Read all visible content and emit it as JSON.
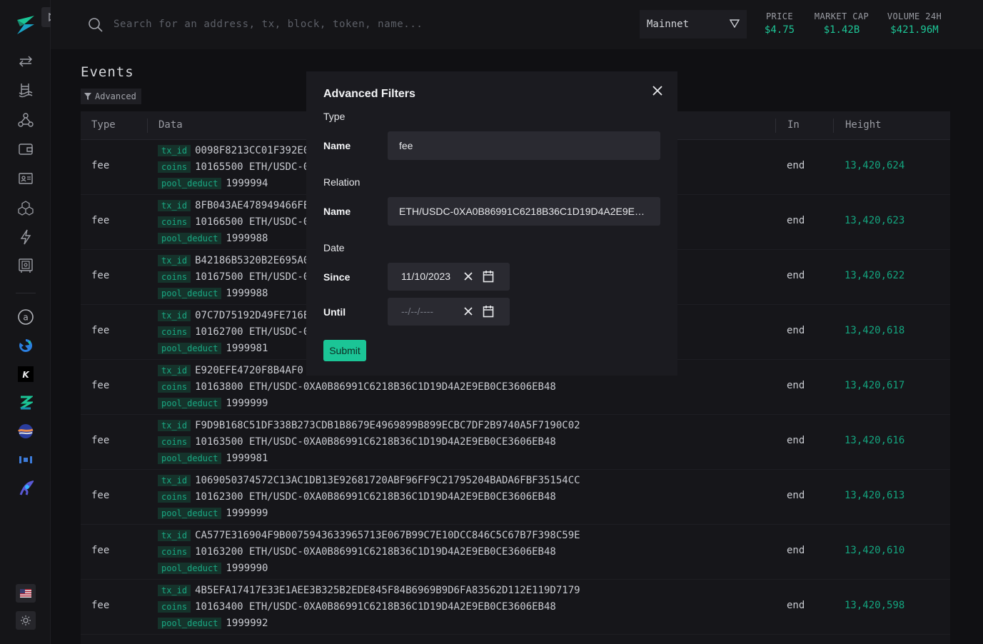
{
  "topbar": {
    "search_placeholder": "Search for an address, tx, block, token, name...",
    "network": "Mainnet",
    "stats": [
      {
        "label": "PRICE",
        "value": "$4.75"
      },
      {
        "label": "MARKET CAP",
        "value": "$1.42B"
      },
      {
        "label": "VOLUME 24H",
        "value": "$421.96M"
      }
    ]
  },
  "page": {
    "title": "Events",
    "advanced_chip": "Advanced"
  },
  "table": {
    "headers": {
      "type": "Type",
      "data": "Data",
      "in": "In",
      "height": "Height"
    },
    "key_labels": {
      "tx_id": "tx_id",
      "coins": "coins",
      "pool_deduct": "pool_deduct"
    },
    "rows": [
      {
        "type": "fee",
        "tx_id": "0098F8213CC01F392E0",
        "coins": "10165500 ETH/USDC-0",
        "pool_deduct": "1999994",
        "in": "end",
        "height": "13,420,624"
      },
      {
        "type": "fee",
        "tx_id": "8FB043AE478949466FE",
        "coins": "10166500 ETH/USDC-0",
        "pool_deduct": "1999988",
        "in": "end",
        "height": "13,420,623"
      },
      {
        "type": "fee",
        "tx_id": "B42186B5320B2E695A0",
        "coins": "10167500 ETH/USDC-0",
        "pool_deduct": "1999988",
        "in": "end",
        "height": "13,420,622"
      },
      {
        "type": "fee",
        "tx_id": "07C7D75192D49FE716E",
        "coins": "10162700 ETH/USDC-0",
        "pool_deduct": "1999981",
        "in": "end",
        "height": "13,420,618"
      },
      {
        "type": "fee",
        "tx_id": "E920EFE4720F8B4AF0",
        "coins": "10163800 ETH/USDC-0XA0B86991C6218B36C1D19D4A2E9EB0CE3606EB48",
        "pool_deduct": "1999999",
        "in": "end",
        "height": "13,420,617"
      },
      {
        "type": "fee",
        "tx_id": "F9D9B168C51DF338B273CDB1B8679E4969899B899ECBC7DF2B9740A5F7190C02",
        "coins": "10163500 ETH/USDC-0XA0B86991C6218B36C1D19D4A2E9EB0CE3606EB48",
        "pool_deduct": "1999981",
        "in": "end",
        "height": "13,420,616"
      },
      {
        "type": "fee",
        "tx_id": "1069050374572C13AC1DB13E92681720ABF96FF9C21795204BADA6FBF35154CC",
        "coins": "10162300 ETH/USDC-0XA0B86991C6218B36C1D19D4A2E9EB0CE3606EB48",
        "pool_deduct": "1999999",
        "in": "end",
        "height": "13,420,613"
      },
      {
        "type": "fee",
        "tx_id": "CA577E316904F9B0075943633965713E067B99C7E10DCC846C5C67B7F398C59E",
        "coins": "10163200 ETH/USDC-0XA0B86991C6218B36C1D19D4A2E9EB0CE3606EB48",
        "pool_deduct": "1999990",
        "in": "end",
        "height": "13,420,610"
      },
      {
        "type": "fee",
        "tx_id": "4B5EFA17417E33E1AEE3B325B2EDE845F84B6969B9D6FA83562D112E119D7179",
        "coins": "10163400 ETH/USDC-0XA0B86991C6218B36C1D19D4A2E9EB0CE3606EB48",
        "pool_deduct": "1999992",
        "in": "end",
        "height": "13,420,598"
      }
    ]
  },
  "modal": {
    "title": "Advanced Filters",
    "type_section": "Type",
    "type_name_label": "Name",
    "type_name_value": "fee",
    "relation_section": "Relation",
    "relation_name_label": "Name",
    "relation_name_value": "ETH/USDC-0XA0B86991C6218B36C1D19D4A2E9EB0CE3606EB48",
    "date_section": "Date",
    "since_label": "Since",
    "since_value": "11/10/2023",
    "until_label": "Until",
    "until_value": "--/--/----",
    "submit_label": "Submit"
  },
  "colors": {
    "accent": "#1bc596",
    "height_link": "#13a57f",
    "tag_bg": "#15332b"
  }
}
